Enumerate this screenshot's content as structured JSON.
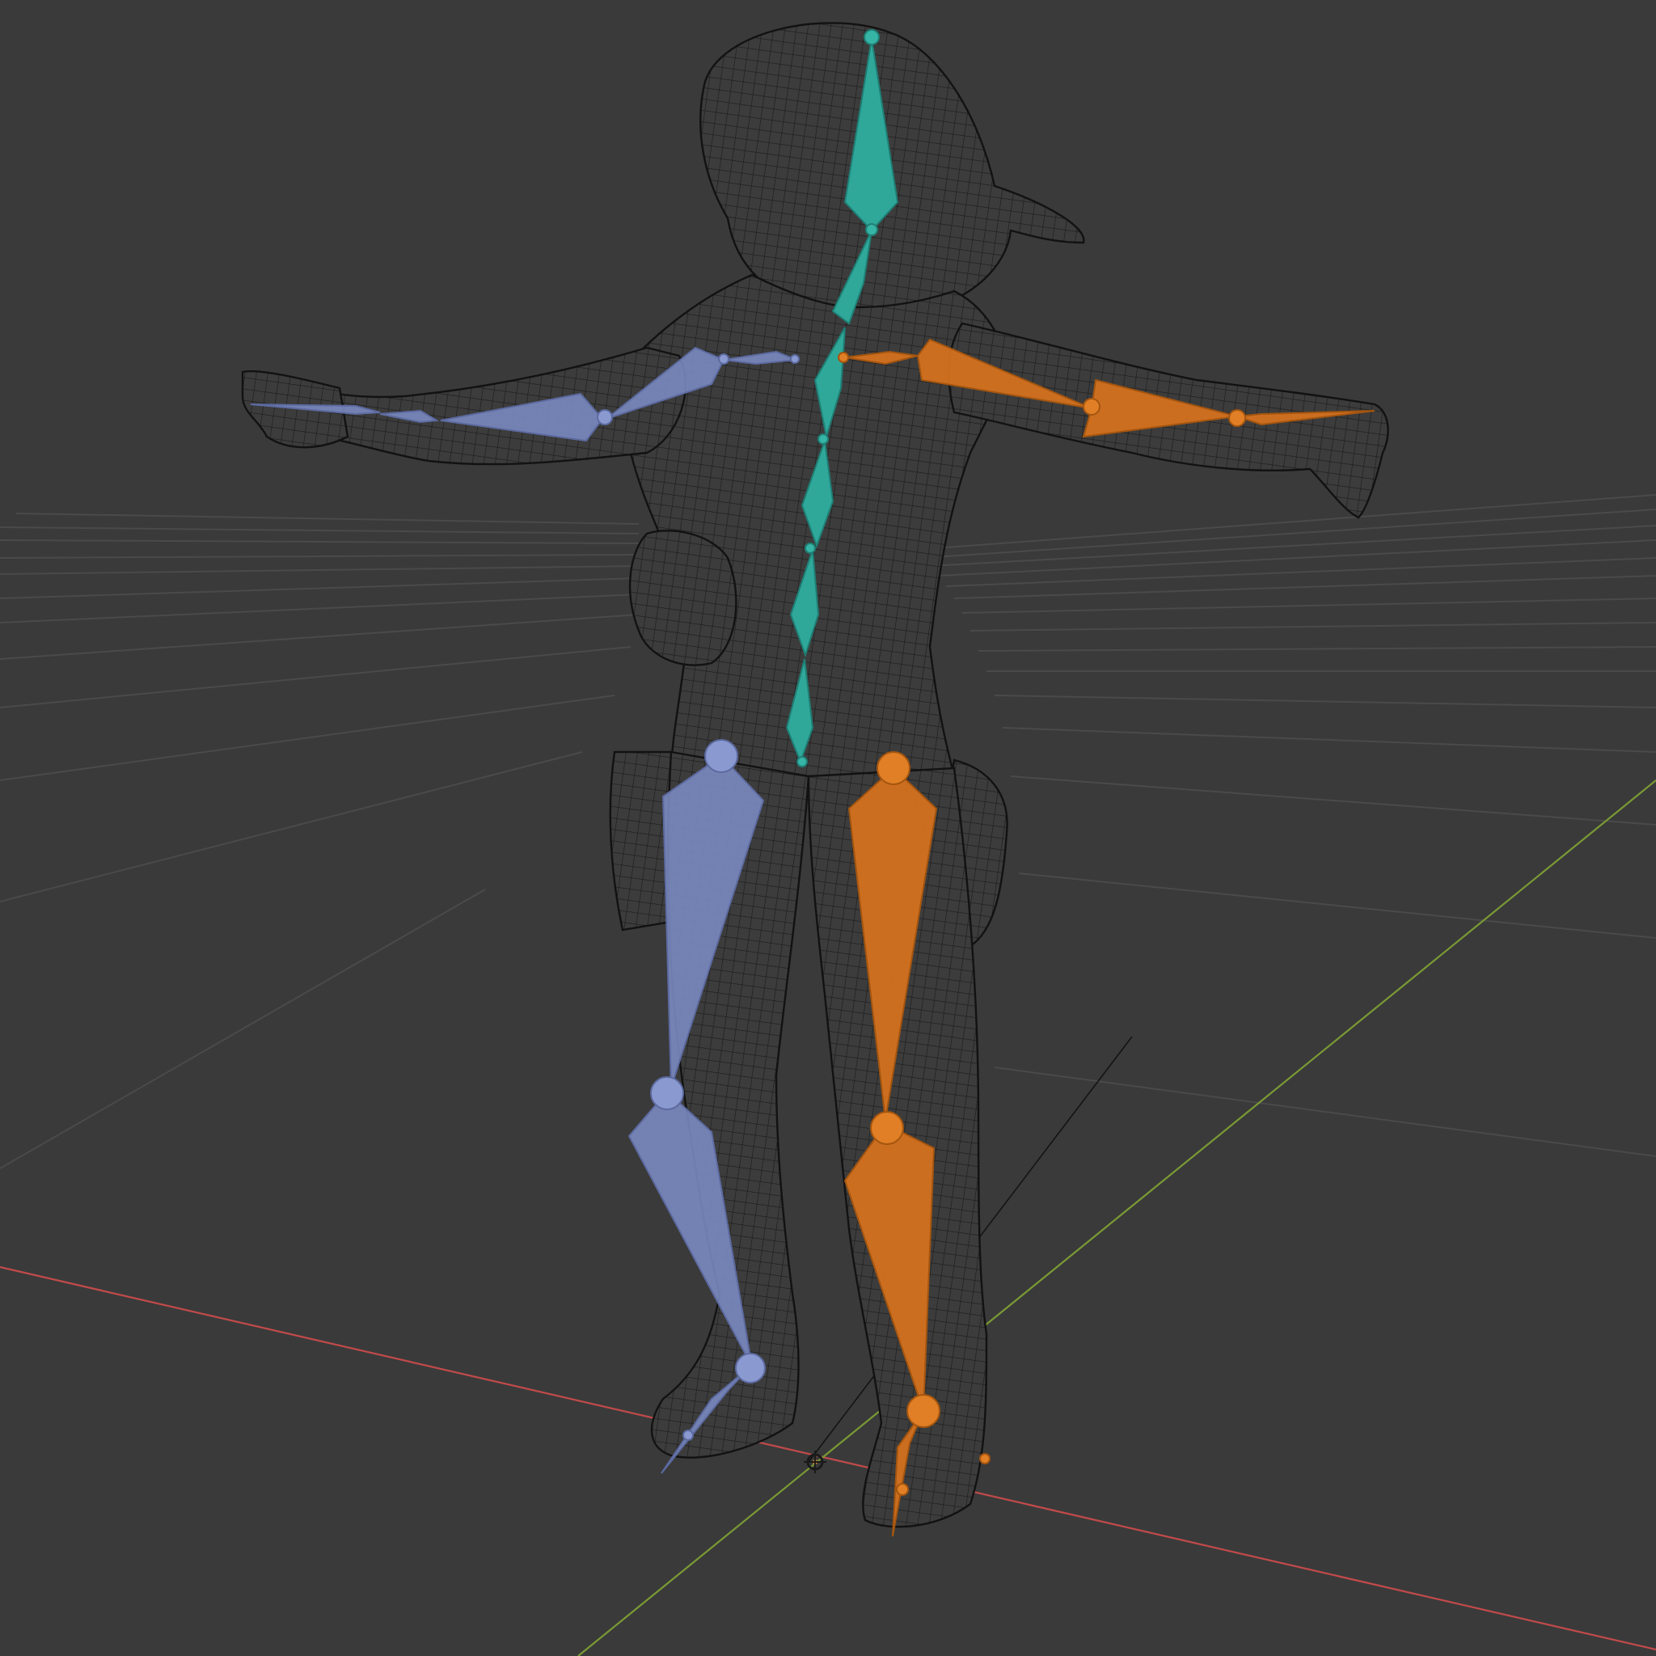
{
  "viewport": {
    "background_color": "#3a3a3a",
    "grid_color": "#4a4a4a",
    "x_axis_color": "#c24a4a",
    "y_axis_color": "#7a9a34",
    "mesh_wire_color": "#141414",
    "mesh_display": "wireframe"
  },
  "armature": {
    "center_bone_color": "#2fa89a",
    "left_side_color": "#7c8cc4",
    "right_side_color": "#d9731e",
    "bone_display": "octahedral",
    "pose": "T-pose"
  },
  "origin_marker_icon": "origin-cursor-icon"
}
